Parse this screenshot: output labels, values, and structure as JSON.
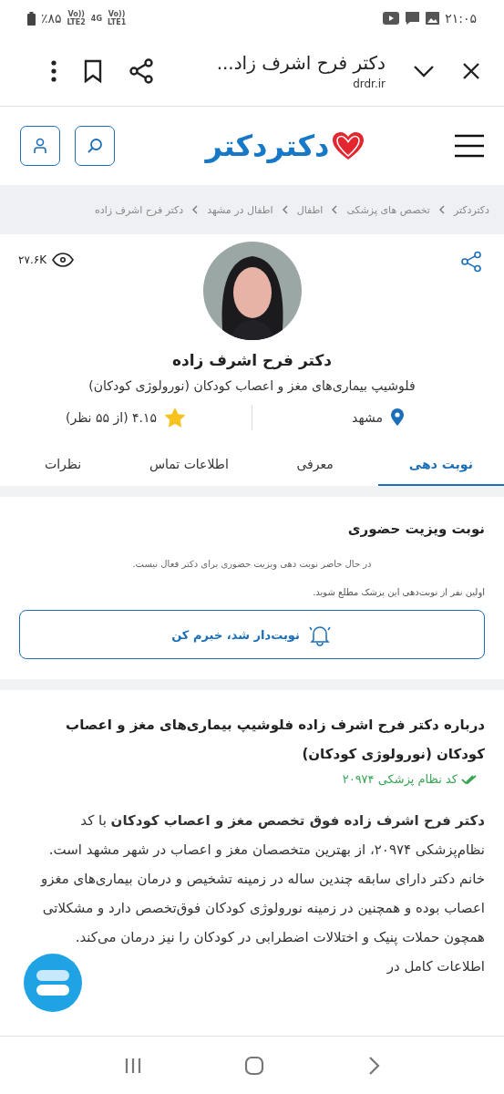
{
  "status_bar": {
    "time": "۲۱:۰۵",
    "battery": "٪۸۵",
    "signal_labels": [
      {
        "top": "Vo))",
        "bottom": "LTE1"
      },
      {
        "top": "4G"
      },
      {
        "top": "Vo))",
        "bottom": "LTE2"
      }
    ]
  },
  "browser": {
    "title": "دکتر فرح اشرف زاد...",
    "url": "drdr.ir"
  },
  "site_header": {
    "logo": "دکتردکتر"
  },
  "breadcrumb": [
    "دکتردکتر",
    "تخصص های پزشکی",
    "اطفال",
    "اطفال در مشهد",
    "دکتر فرح اشرف زاده"
  ],
  "profile": {
    "views": "۲۷.۶K",
    "name": "دکتر فرح اشرف زاده",
    "specialty": "فلوشیپ بیماری‌های مغز و اعصاب کودکان (نورولوژی کودکان)",
    "city": "مشهد",
    "rating": "۴.۱۵ (از ۵۵ نظر)"
  },
  "tabs": [
    {
      "label": "نوبت دهی",
      "selected": true
    },
    {
      "label": "معرفی",
      "selected": false
    },
    {
      "label": "اطلاعات تماس",
      "selected": false
    },
    {
      "label": "نظرات",
      "selected": false
    }
  ],
  "appointment": {
    "title": "نوبت ویزیت حضوری",
    "notice": "در حال حاضر نوبت دهی ویزیت حضوری برای دکتر فعال نیست.",
    "hint": "اولین نفر از نوبت‌دهی این پزشک مطلع شوید.",
    "notify_button": "نوبت‌دار شد، خبرم کن"
  },
  "about": {
    "title": "درباره دکتر فرح اشرف زاده فلوشیپ بیماری‌های مغز و اعصاب کودکان (نورولوژی کودکان)",
    "code": "کد نظام پزشکی ۲۰۹۷۴",
    "paragraph": "**دکتر فرح اشرف زاده فوق تخصص مغز و اعصاب کودکان** با کد نظام‌پزشکی ۲۰۹۷۴، از بهترین متخصصان مغز و اعصاب در شهر مشهد است. خانم دکتر دارای سابقه چندین ساله در زمینه تشخیص و درمان بیماری‌های مغزو اعصاب بوده و همچنین در زمینه نورولوژی کودکان فوق‌تخصص دارد و مشکلاتی همچون حملات پنیک و اختلالات اضطرابی در کودکان را نیز درمان می‌کند. اطلاعات کامل در"
  }
}
